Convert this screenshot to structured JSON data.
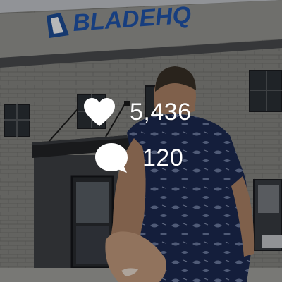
{
  "photo": {
    "sign_text": "BLADEHQ"
  },
  "overlay": {
    "likes_count": "5,436",
    "comments_count": "120",
    "like_icon": "heart-icon",
    "comment_icon": "speech-bubble-icon",
    "icon_color": "#ffffff"
  }
}
